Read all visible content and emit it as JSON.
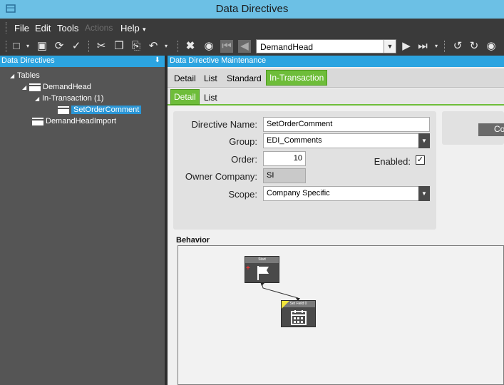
{
  "window": {
    "title": "Data Directives"
  },
  "menu": {
    "items": [
      {
        "label": "File",
        "enabled": true
      },
      {
        "label": "Edit",
        "enabled": true
      },
      {
        "label": "Tools",
        "enabled": true
      },
      {
        "label": "Actions",
        "enabled": false
      },
      {
        "label": "Help",
        "enabled": true
      }
    ]
  },
  "toolbar": {
    "key_value": "DemandHead",
    "icons": [
      "new-icon",
      "save-icon",
      "refresh-icon",
      "clear-icon",
      "cut-icon",
      "copy-icon",
      "paste-icon",
      "undo-icon",
      "delete-icon",
      "search-icon",
      "first-icon",
      "previous-icon",
      "next-icon",
      "last-icon",
      "back-icon",
      "forward-icon",
      "home-icon"
    ]
  },
  "left_panel": {
    "title": "Data Directives",
    "pin": "⬇",
    "tree": {
      "root": "Tables",
      "table": "DemandHead",
      "group": "In-Transaction (1)",
      "selected": "SetOrderComment",
      "other": "DemandHeadImport"
    }
  },
  "right_panel": {
    "title": "Data Directive Maintenance",
    "tabs": [
      "Detail",
      "List",
      "Standard",
      "In-Transaction"
    ],
    "active_tab": "In-Transaction",
    "subtabs": [
      "Detail",
      "List"
    ],
    "active_subtab": "Detail"
  },
  "form": {
    "directive_name_label": "Directive Name:",
    "directive_name": "SetOrderComment",
    "group_label": "Group:",
    "group": "EDI_Comments",
    "order_label": "Order:",
    "order": "10",
    "enabled_label": "Enabled:",
    "enabled": true,
    "owner_company_label": "Owner Company:",
    "owner_company": "SI",
    "scope_label": "Scope:",
    "scope": "Company Specific"
  },
  "side_button": {
    "label": "Co"
  },
  "behavior": {
    "label": "Behavior",
    "nodes": [
      {
        "id": "start",
        "label": "Start",
        "icon": "flag-icon"
      },
      {
        "id": "set-field",
        "label": "Set Field 0",
        "icon": "calendar-icon"
      }
    ]
  },
  "colors": {
    "accent": "#2ca4e0",
    "tab_active": "#6ebd3a",
    "title_bar": "#6cc0e5"
  }
}
